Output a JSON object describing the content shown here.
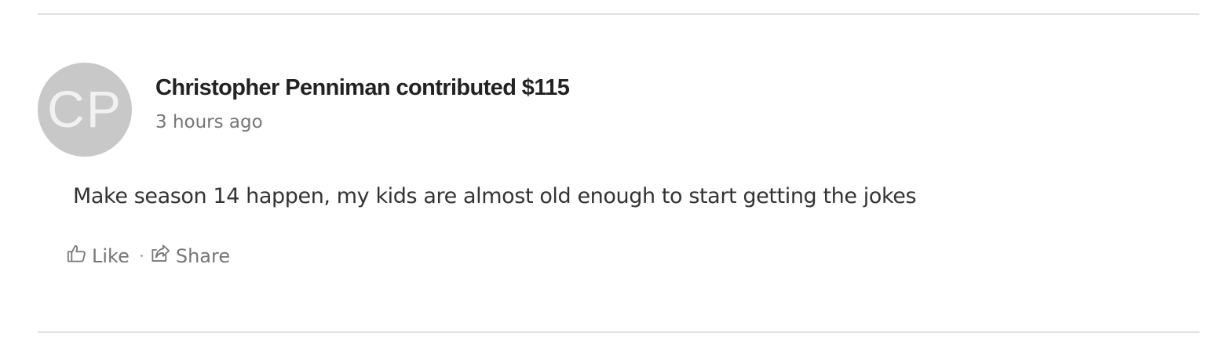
{
  "contribution": {
    "avatar_initials": "CP",
    "headline": "Christopher Penniman contributed $115",
    "timestamp": "3 hours ago",
    "comment": "Make season 14 happen, my kids are almost old enough to start getting the jokes"
  },
  "actions": {
    "like_label": "Like",
    "share_label": "Share"
  },
  "colors": {
    "avatar_bg": "#c8c8c8",
    "headline": "#222222",
    "muted": "#767676",
    "divider": "#e0e0e0"
  }
}
